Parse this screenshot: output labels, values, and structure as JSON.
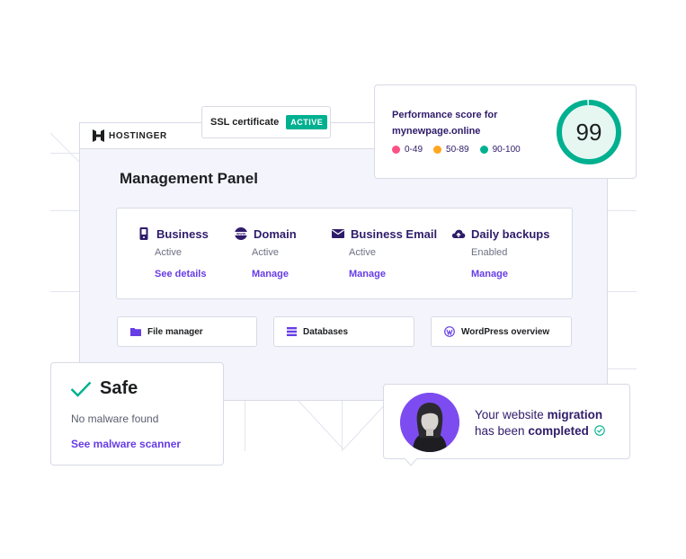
{
  "brand": {
    "name": "HOSTINGER"
  },
  "ssl": {
    "label": "SSL certificate",
    "status": "ACTIVE",
    "status_color": "#00b090"
  },
  "performance": {
    "title_line1": "Performance score for",
    "title_line2": "mynewpage.online",
    "score": "99",
    "score_fraction": 0.99,
    "legend": [
      {
        "label": "0-49",
        "color": "#fc5185"
      },
      {
        "label": "50-89",
        "color": "#ffa51f"
      },
      {
        "label": "90-100",
        "color": "#00b090"
      }
    ]
  },
  "panel": {
    "title": "Management Panel",
    "services": [
      {
        "title": "Business",
        "status": "Active",
        "link": "See details",
        "icon": "phone-icon"
      },
      {
        "title": "Domain",
        "status": "Active",
        "link": "Manage",
        "icon": "www-globe-icon"
      },
      {
        "title": "Business Email",
        "status": "Active",
        "link": "Manage",
        "icon": "mail-icon"
      },
      {
        "title": "Daily backups",
        "status": "Enabled",
        "link": "Manage",
        "icon": "cloud-upload-icon"
      }
    ],
    "tools": [
      {
        "label": "File manager",
        "icon": "folder-icon"
      },
      {
        "label": "Databases",
        "icon": "database-icon"
      },
      {
        "label": "WordPress overview",
        "icon": "wordpress-icon"
      }
    ]
  },
  "safe": {
    "title": "Safe",
    "subtitle": "No malware found",
    "link": "See malware scanner"
  },
  "migration": {
    "line1_prefix": "Your website ",
    "line1_bold": "migration",
    "line2_prefix": "has been ",
    "line2_bold": "completed"
  },
  "colors": {
    "accent": "#673de6",
    "navy": "#2f1c6a",
    "success": "#00b090"
  }
}
